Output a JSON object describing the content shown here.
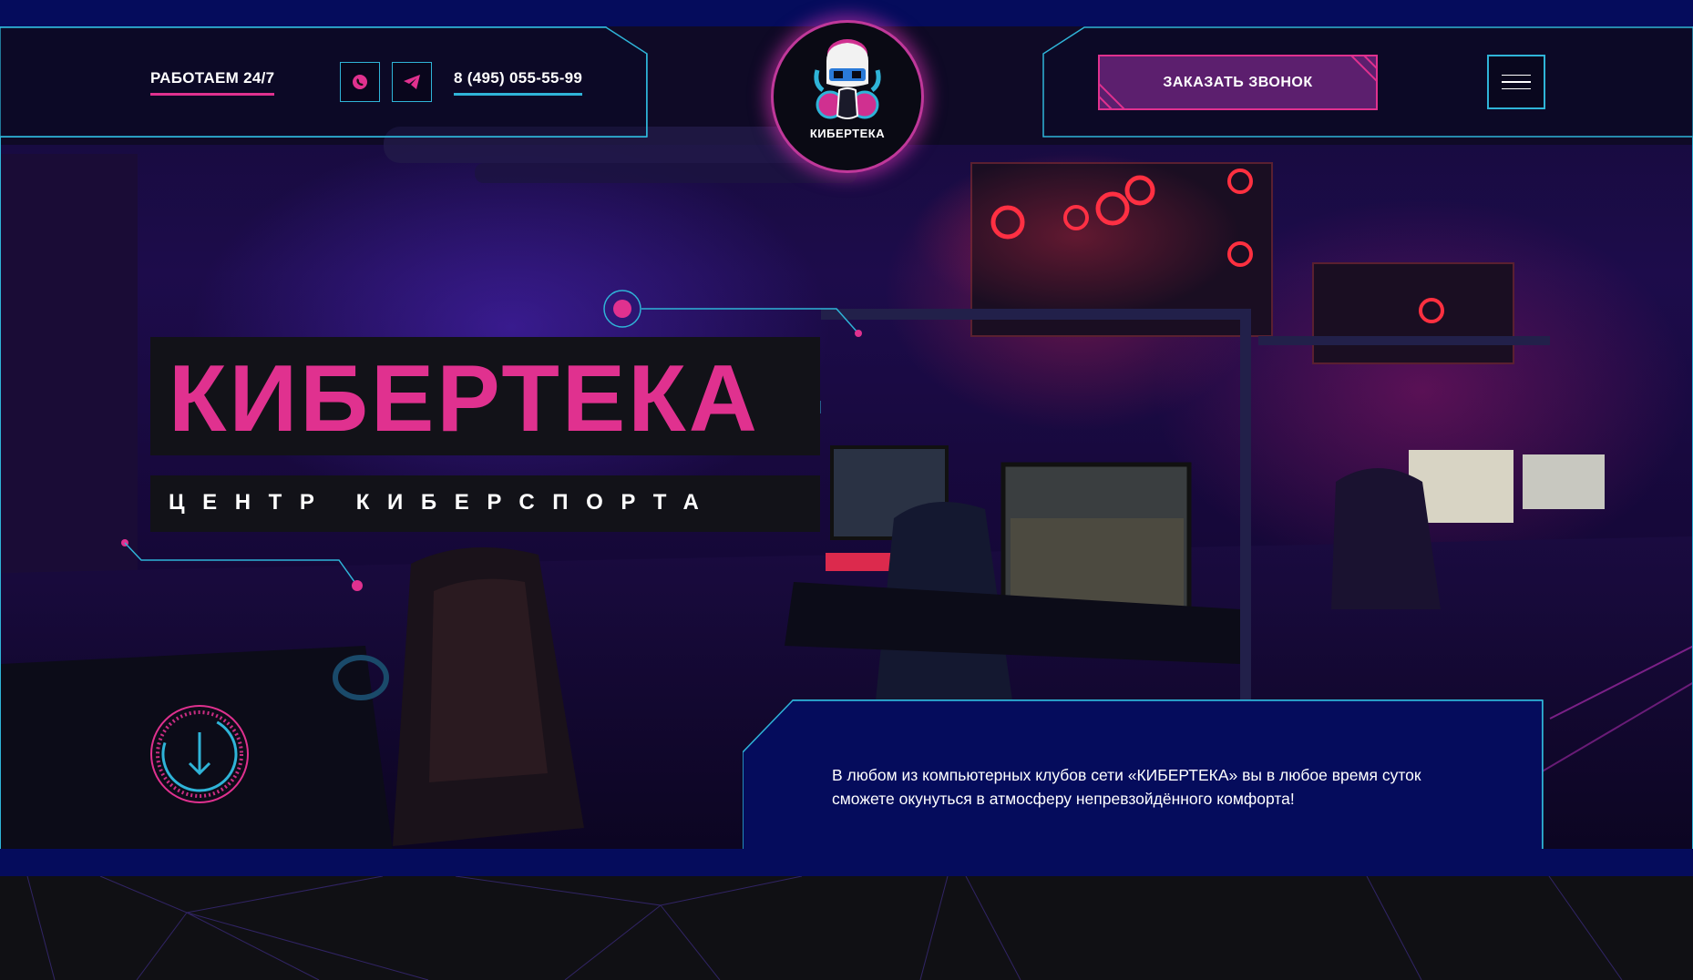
{
  "header": {
    "work_hours": "РАБОТАЕМ 24/7",
    "phone": "8 (495) 055-55-99",
    "social": [
      {
        "name": "whatsapp",
        "icon": "whatsapp-icon"
      },
      {
        "name": "telegram",
        "icon": "telegram-icon"
      }
    ],
    "logo_text": "КИБЕРТЕКА",
    "call_button": "ЗАКАЗАТЬ ЗВОНОК",
    "menu_icon": "hamburger-icon"
  },
  "hero": {
    "title": "КИБЕРТЕКА",
    "subtitle": "ЦЕНТР КИБЕРСПОРТА",
    "scroll_icon": "arrow-down-icon",
    "info_text": "В любом из компьютерных клубов сети «КИБЕРТЕКА» вы в любое время суток сможете окунуться в атмосферу непревзойдённого комфорта!"
  },
  "colors": {
    "accent_pink": "#e0318f",
    "accent_cyan": "#2fb4d8",
    "panel_blue": "#050c5c",
    "button_fill": "#5c1f6e"
  }
}
